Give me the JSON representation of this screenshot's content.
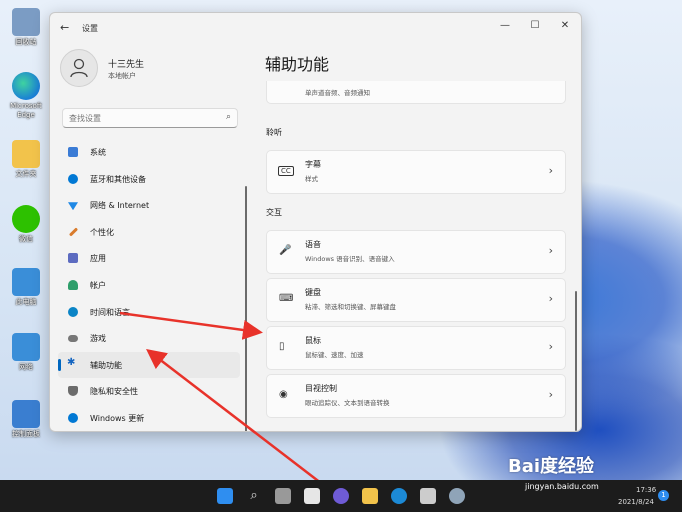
{
  "desktop": {
    "icons": [
      {
        "label": "回收站",
        "color": "#6d8fb8"
      },
      {
        "label": "Microsoft Edge",
        "color": "#1c8ad6"
      },
      {
        "label": "文件夹",
        "color": "#f0c040"
      },
      {
        "label": "微信",
        "color": "#2dc100"
      },
      {
        "label": "此电脑",
        "color": "#3a8ed8"
      },
      {
        "label": "网络",
        "color": "#3a8ed8"
      },
      {
        "label": "控制面板",
        "color": "#3a7ed0"
      }
    ]
  },
  "window": {
    "title": "设置",
    "back_glyph": "←",
    "controls": {
      "minimize": "—",
      "maximize": "☐",
      "close": "✕"
    }
  },
  "user": {
    "name": "十三先生",
    "type": "本地帐户"
  },
  "search": {
    "placeholder": "查找设置",
    "icon": "search-icon"
  },
  "sidebar": {
    "items": [
      {
        "label": "系统",
        "color": "#3a7bd5"
      },
      {
        "label": "蓝牙和其他设备",
        "color": "#0078d4"
      },
      {
        "label": "网络 & Internet",
        "color": "#1e88e5"
      },
      {
        "label": "个性化",
        "color": "#d97b2c"
      },
      {
        "label": "应用",
        "color": "#5c6bc0"
      },
      {
        "label": "帐户",
        "color": "#2e9e6a"
      },
      {
        "label": "时间和语言",
        "color": "#0a84c6"
      },
      {
        "label": "游戏",
        "color": "#777777"
      },
      {
        "label": "辅助功能",
        "color": "#1565c0"
      },
      {
        "label": "隐私和安全性",
        "color": "#6b6b6b"
      },
      {
        "label": "Windows 更新",
        "color": "#0078d4"
      }
    ],
    "active_index": 8,
    "accent": "#0067c0"
  },
  "main": {
    "title": "辅助功能",
    "top_card": {
      "subtitle": "单声道音频、音频通知"
    },
    "section_hearing": "聆听",
    "captions": {
      "title": "字幕",
      "subtitle": "样式",
      "icon": "cc-icon"
    },
    "section_interaction": "交互",
    "cards": [
      {
        "title": "语音",
        "subtitle": "Windows 语音识别、语音键入",
        "icon": "microphone-icon",
        "glyph": "🎤"
      },
      {
        "title": "键盘",
        "subtitle": "粘滞、筛选和切换键、屏幕键盘",
        "icon": "keyboard-icon",
        "glyph": "⌨"
      },
      {
        "title": "鼠标",
        "subtitle": "鼠标键、速度、加速",
        "icon": "mouse-icon",
        "glyph": "▯"
      },
      {
        "title": "目视控制",
        "subtitle": "眼动追踪仪、文本到语音转换",
        "icon": "eye-control-icon",
        "glyph": "◉"
      }
    ],
    "chevron": "›"
  },
  "taskbar": {
    "time": "17:36",
    "date": "2021/8/24",
    "notification_count": "1"
  },
  "watermark": {
    "brand": "Bai度经验",
    "url": "jingyan.baidu.com"
  },
  "annotation_color": "#e8322a"
}
